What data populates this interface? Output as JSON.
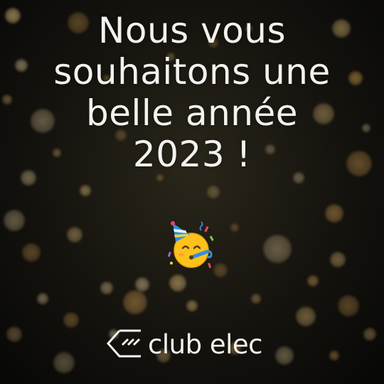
{
  "headline": {
    "line1": "Nous vous",
    "line2": "souhaitons une",
    "line3": "belle année",
    "line4": "2023 !"
  },
  "emoji": "partying-face-icon",
  "brand": {
    "name": "club elec"
  },
  "colors": {
    "text": "#f2f2ee",
    "bokeh_gold": "#d9a954",
    "background": "#15130e"
  }
}
